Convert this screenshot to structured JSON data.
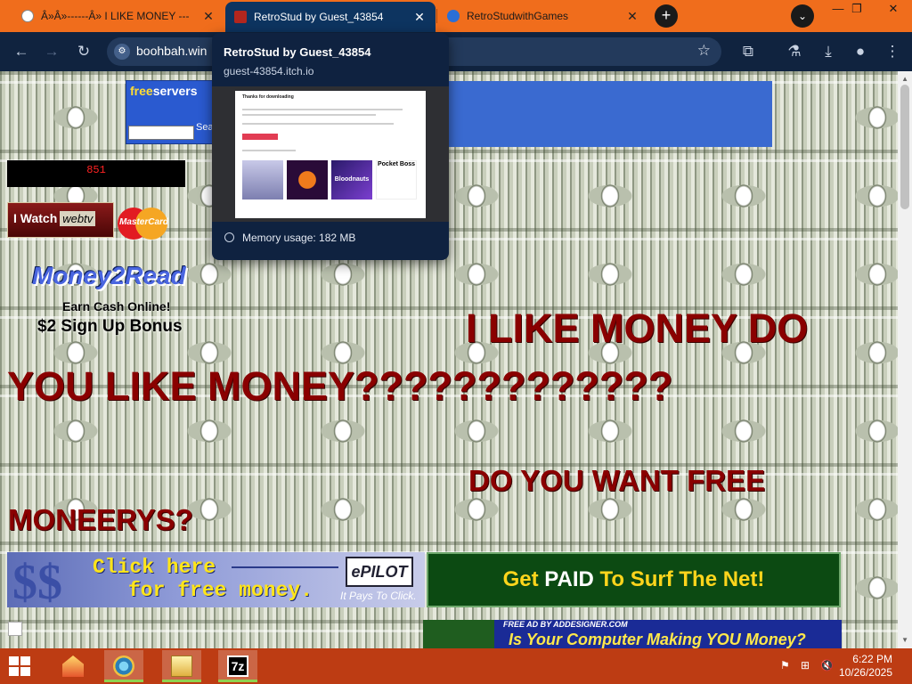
{
  "browser": {
    "tabs": [
      {
        "title": "Â»Â»------Â» I LIKE MONEY ---",
        "close": "✕"
      },
      {
        "title": "RetroStud by Guest_43854",
        "close": "✕"
      },
      {
        "title": "RetroStudwithGames",
        "close": "✕"
      }
    ],
    "new_tab": "+",
    "tab_search": "⌄",
    "window_controls": {
      "minimize": "—",
      "maximize": "❐",
      "close": "✕"
    },
    "nav": {
      "back": "←",
      "forward": "→",
      "reload": "↻"
    },
    "address": "boohbah.win",
    "site_info": "⚙",
    "bookmark": "☆",
    "toolbar_icons": {
      "extensions": "⧉",
      "labs": "⚗",
      "downloads": "⤓",
      "profile": "●",
      "menu": "⋮"
    }
  },
  "hover_card": {
    "title": "RetroStud by Guest_43854",
    "url": "guest-43854.itch.io",
    "memory": "Memory usage: 182 MB",
    "preview": {
      "heading": "Thanks for downloading",
      "thumbs": [
        "Bloodnauts",
        "Pocket Boss"
      ]
    }
  },
  "page": {
    "freeservers": {
      "logo_a": "free",
      "logo_b": "servers",
      "search_label": "Sea"
    },
    "counter": "851",
    "webtv": {
      "label": "I Watch",
      "brand": "webtv"
    },
    "mastercard": "MasterCard",
    "money2read": {
      "logo": "Money2Read",
      "tagline": "Earn Cash Online!",
      "bonus": "$2 Sign Up Bonus"
    },
    "headline1": "I LIKE MONEY DO",
    "headline2": "YOU LIKE MONEY?????????????",
    "headline3": "DO YOU WANT FREE",
    "headline4": "MONEERYS?",
    "epilot": {
      "symbol": "$$",
      "line1": "Click here",
      "line2": "for free money.",
      "logo": "ePILOT",
      "tagline": "It Pays To Click."
    },
    "paid": {
      "a": "Get ",
      "b": "PAID",
      "c": " To Surf The Net!"
    },
    "addesigner": {
      "credit": "FREE AD BY ADDESIGNER.COM",
      "question": "Is Your Computer Making YOU Money?"
    }
  },
  "taskbar": {
    "time": "6:22 PM",
    "date": "10/26/2025",
    "apps": [
      "file-manager",
      "browser",
      "explorer",
      "7-zip"
    ],
    "app_7zip_label": "7z",
    "tray": {
      "flag": "⚑",
      "network": "⊞",
      "volume": "🔇"
    }
  },
  "colors": {
    "tab_strip": "#f06d1c",
    "toolbar": "#10233f",
    "headline": "#8a0000",
    "taskbar": "#bd3c13"
  }
}
